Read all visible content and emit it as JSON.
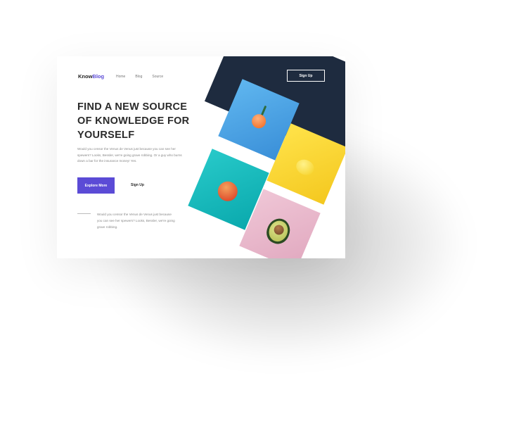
{
  "header": {
    "logo_part1": "Know",
    "logo_part2": "Blog",
    "nav": [
      "Home",
      "Blog",
      "Source"
    ],
    "signup_label": "Sign Up"
  },
  "hero": {
    "headline": "FIND A NEW SOURCE OF KNOWLEDGE FOR YOURSELF",
    "paragraph": "Would you censor the Venus de Venus just because you can see her spewers? Looks, Bessler, we're going grave robbing. Or a guy who burns down a bar for the insurance money! Yes.",
    "primary_button": "Explore More",
    "secondary_button": "Sign Up"
  },
  "quote": {
    "text": "Would you censor the Venus de Venus just because you can see her spewers? Looks, Bessler, we're going grave robbing."
  },
  "colors": {
    "accent": "#5b4bd6",
    "dark_panel": "#1e2b3f",
    "tile_blue": "#4aa6e6",
    "tile_yellow": "#f8d636",
    "tile_teal": "#15b9bc",
    "tile_pink": "#e8b6cb"
  },
  "illustration_icons": [
    "orange-icon",
    "lemon-icon",
    "apple-icon",
    "avocado-icon"
  ]
}
